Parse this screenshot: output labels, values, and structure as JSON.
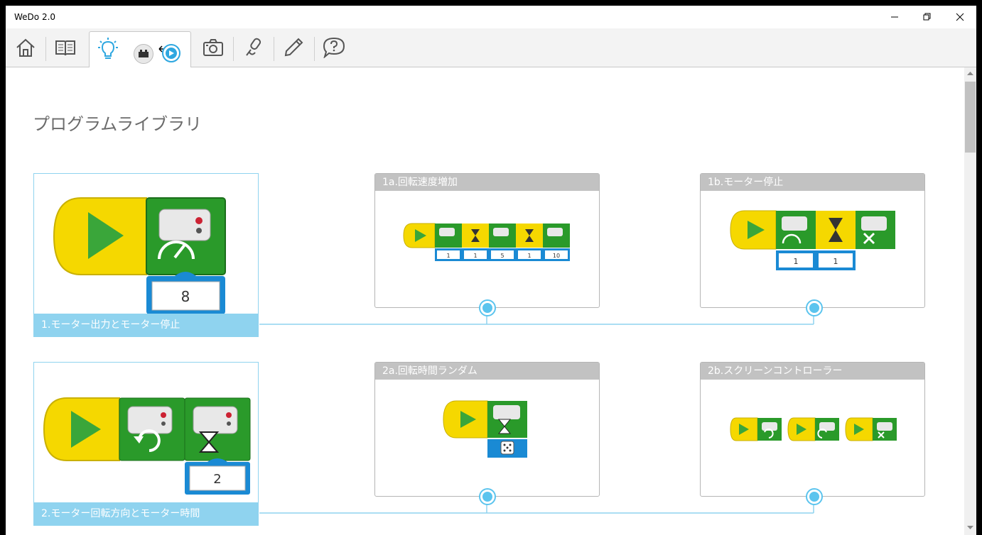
{
  "window": {
    "title": "WeDo 2.0"
  },
  "page": {
    "title": "プログラムライブラリ"
  },
  "library": {
    "row1": {
      "main": {
        "label": "1.モーター出力とモーター停止",
        "value": "8"
      },
      "sub_a": {
        "title": "1a.回転速度増加",
        "values": [
          "1",
          "1",
          "5",
          "1",
          "10"
        ]
      },
      "sub_b": {
        "title": "1b.モーター停止",
        "values": [
          "1",
          "1"
        ]
      }
    },
    "row2": {
      "main": {
        "label": "2.モーター回転方向とモーター時間",
        "value": "2"
      },
      "sub_a": {
        "title": "2a.回転時間ランダム"
      },
      "sub_b": {
        "title": "2b.スクリーンコントローラー"
      }
    }
  },
  "colors": {
    "accent": "#5bc4ee",
    "card_label_bg": "#8fd3ef",
    "sub_header_bg": "#c2c2c2",
    "block_yellow": "#f5d800",
    "block_green": "#2a9a2a",
    "block_blue": "#1a8ad4"
  }
}
